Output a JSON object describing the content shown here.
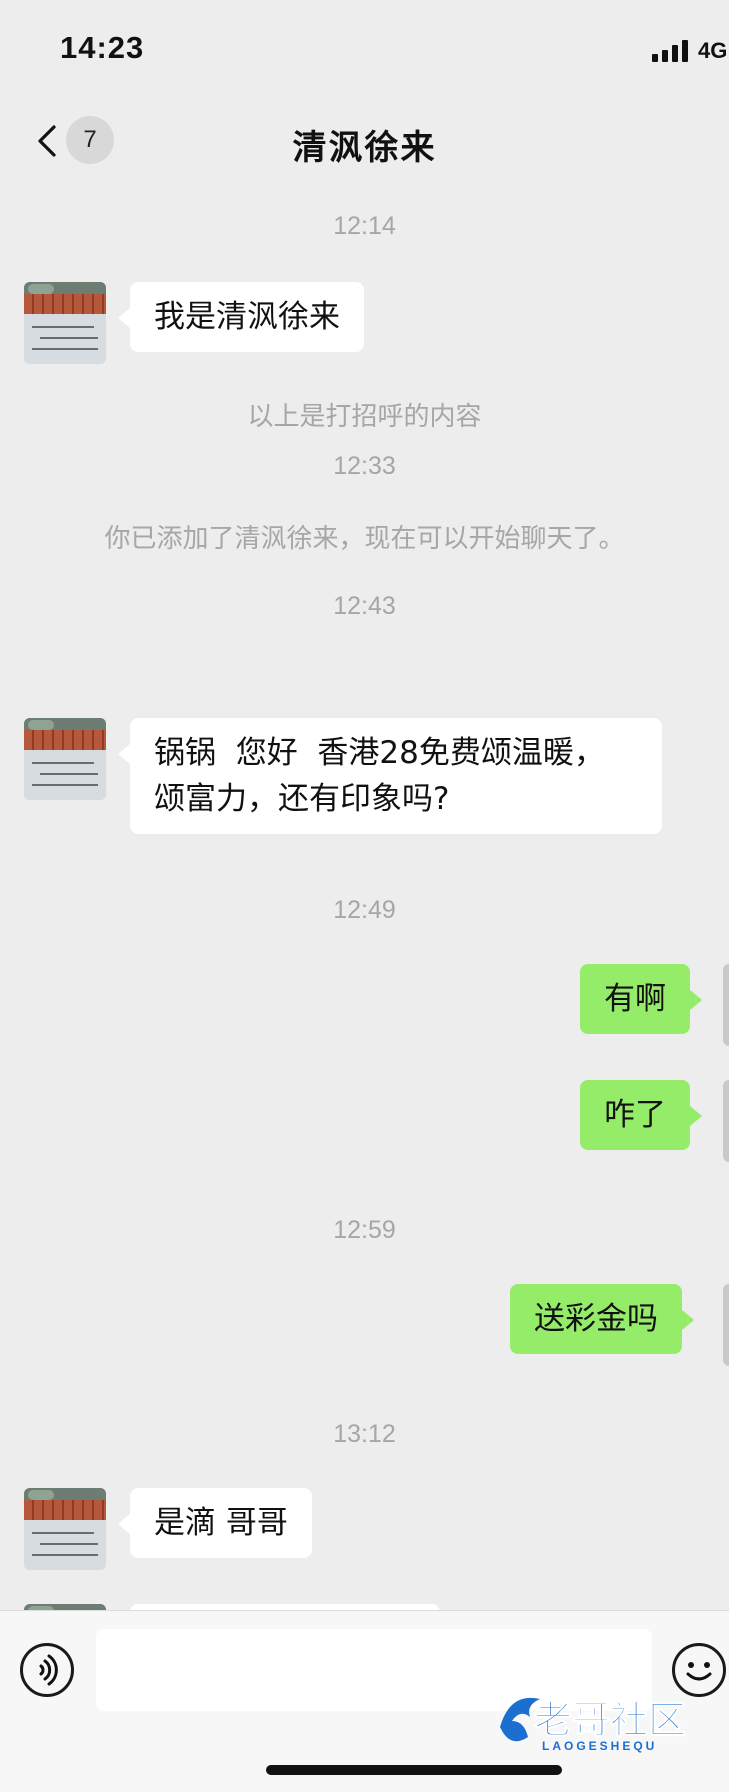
{
  "status_bar": {
    "time": "14:23",
    "network": "4G"
  },
  "nav": {
    "unread_count": "7",
    "title": "清沨徐来"
  },
  "chat": {
    "times": [
      "12:14",
      "12:33",
      "12:43",
      "12:49",
      "12:59",
      "13:12"
    ],
    "system_messages": [
      "以上是打招呼的内容",
      "你已添加了清沨徐来，现在可以开始聊天了。"
    ],
    "messages": [
      {
        "from": "them",
        "text": "我是清沨徐来"
      },
      {
        "from": "them",
        "text": "锅锅  您好  香港28免费颂温暖，\n颂富力，还有印象吗?"
      },
      {
        "from": "me",
        "text": "有啊"
      },
      {
        "from": "me",
        "text": "咋了"
      },
      {
        "from": "me",
        "text": "送彩金吗"
      },
      {
        "from": "them",
        "text": "是滴 哥哥"
      }
    ]
  },
  "input": {
    "value": "",
    "placeholder": ""
  },
  "watermark": {
    "brand": "老哥社区",
    "sub": "LAOGESHEQU"
  },
  "colors": {
    "background": "#ededed",
    "my_bubble": "#95ec69",
    "their_bubble": "#ffffff",
    "timestamp": "#a6a6a6"
  },
  "icons": [
    "back-icon",
    "voice-icon",
    "emoji-icon"
  ]
}
